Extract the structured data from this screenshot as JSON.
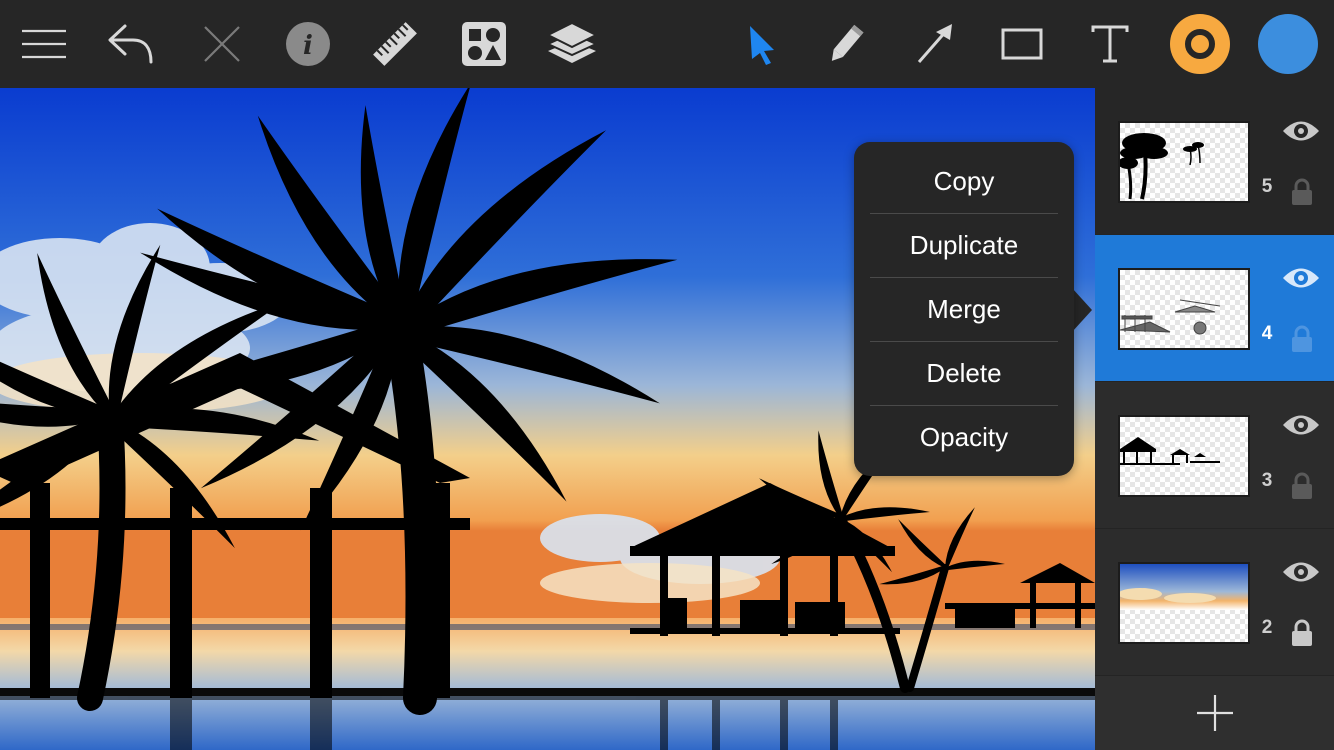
{
  "toolbar": {
    "left_icons": [
      "menu-icon",
      "undo-icon",
      "close-icon",
      "info-icon",
      "ruler-icon",
      "shapes-icon",
      "layers-icon"
    ],
    "right_icons": [
      "select-arrow-icon",
      "pencil-icon",
      "arrow-tool-icon",
      "rectangle-icon",
      "text-tool-icon",
      "stroke-color-icon",
      "fill-color-icon"
    ],
    "active_tool": "select-arrow-icon",
    "accent_color": "#1f86f0",
    "stroke_color": "#f7a940",
    "fill_color": "#3c8ede"
  },
  "context_menu": {
    "items": [
      {
        "label": "Copy"
      },
      {
        "label": "Duplicate"
      },
      {
        "label": "Merge"
      },
      {
        "label": "Delete"
      },
      {
        "label": "Opacity"
      }
    ]
  },
  "layers_panel": {
    "layers": [
      {
        "number": "5",
        "visible": true,
        "locked": true,
        "selected": false
      },
      {
        "number": "4",
        "visible": true,
        "locked": true,
        "selected": true
      },
      {
        "number": "3",
        "visible": true,
        "locked": true,
        "selected": false
      },
      {
        "number": "2",
        "visible": true,
        "locked": true,
        "selected": false
      }
    ],
    "add_icon": "plus-icon",
    "selected_color": "#1f7ad8"
  }
}
